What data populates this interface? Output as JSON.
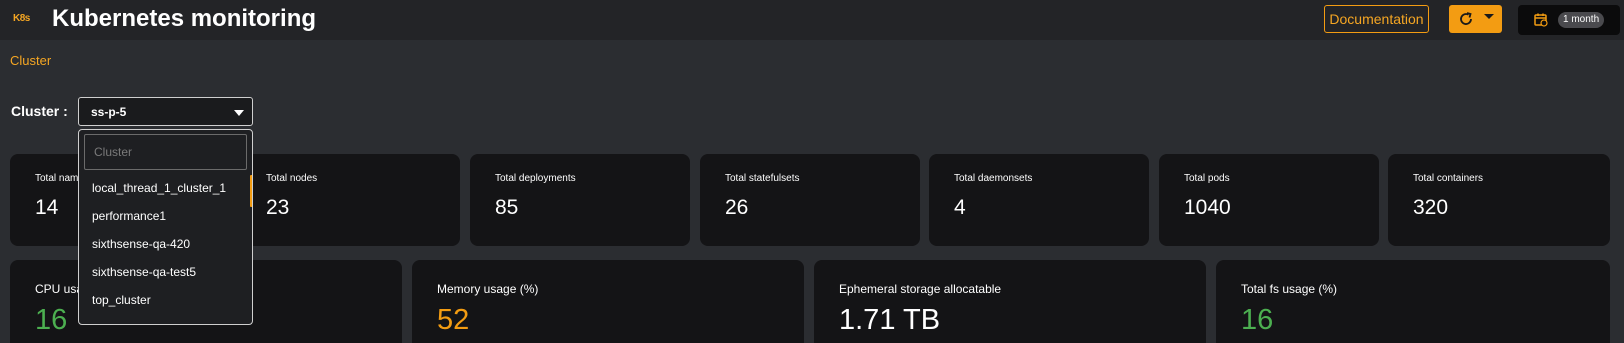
{
  "header": {
    "logo": "K8s",
    "title": "Kubernetes monitoring",
    "documentation_label": "Documentation",
    "time_range": "1 month"
  },
  "breadcrumb": "Cluster",
  "cluster_filter": {
    "label": "Cluster :",
    "selected": "ss-p-5",
    "search_placeholder": "Cluster",
    "options": [
      "local_thread_1_cluster_1",
      "performance1",
      "sixthsense-qa-420",
      "sixthsense-qa-test5",
      "top_cluster"
    ]
  },
  "stats": [
    {
      "label": "Total namespaces",
      "value": "14"
    },
    {
      "label": "Total nodes",
      "value": "23"
    },
    {
      "label": "Total deployments",
      "value": "85"
    },
    {
      "label": "Total statefulsets",
      "value": "26"
    },
    {
      "label": "Total daemonsets",
      "value": "4"
    },
    {
      "label": "Total pods",
      "value": "1040"
    },
    {
      "label": "Total containers",
      "value": "320"
    }
  ],
  "usage": [
    {
      "label": "CPU usage (%)",
      "value": "16",
      "color": "#4caf50"
    },
    {
      "label": "Memory usage (%)",
      "value": "52",
      "color": "#f39c12"
    },
    {
      "label": "Ephemeral storage allocatable",
      "value": "1.71 TB",
      "color": "#ffffff"
    },
    {
      "label": "Total fs usage (%)",
      "value": "16",
      "color": "#4caf50"
    }
  ],
  "colors": {
    "accent": "#f39c12",
    "background": "#2b2d31",
    "card": "#141416",
    "good": "#4caf50"
  }
}
